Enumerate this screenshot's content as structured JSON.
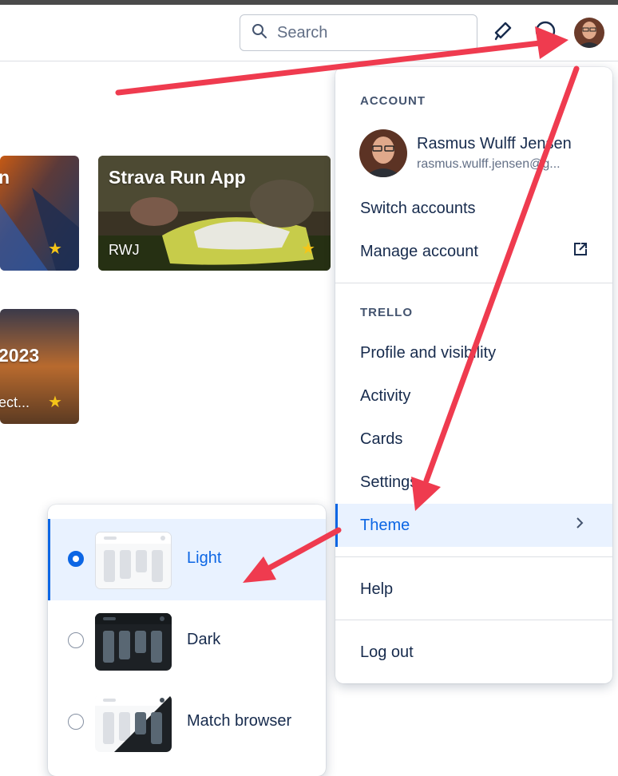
{
  "header": {
    "search_placeholder": "Search",
    "icons": [
      "search-icon",
      "megaphone-icon",
      "help-icon",
      "avatar"
    ]
  },
  "boards": [
    {
      "title": "n",
      "subtitle": "",
      "starred": true
    },
    {
      "title": "Strava Run App",
      "subtitle": "RWJ",
      "starred": true
    },
    {
      "title": "2023",
      "subtitle": "ect...",
      "starred": true
    }
  ],
  "account_menu": {
    "account_label": "ACCOUNT",
    "user_name": "Rasmus Wulff Jensen",
    "user_email": "rasmus.wulff.jensen@g...",
    "switch_accounts": "Switch accounts",
    "manage_account": "Manage account",
    "trello_label": "TRELLO",
    "profile": "Profile and visibility",
    "activity": "Activity",
    "cards": "Cards",
    "settings": "Settings",
    "theme": "Theme",
    "help": "Help",
    "logout": "Log out"
  },
  "theme_menu": {
    "options": [
      {
        "label": "Light",
        "selected": true
      },
      {
        "label": "Dark",
        "selected": false
      },
      {
        "label": "Match browser",
        "selected": false
      }
    ]
  },
  "colors": {
    "accent": "#0c66e4",
    "annotation_arrow": "#ef3b4f",
    "star": "#f5c518"
  }
}
